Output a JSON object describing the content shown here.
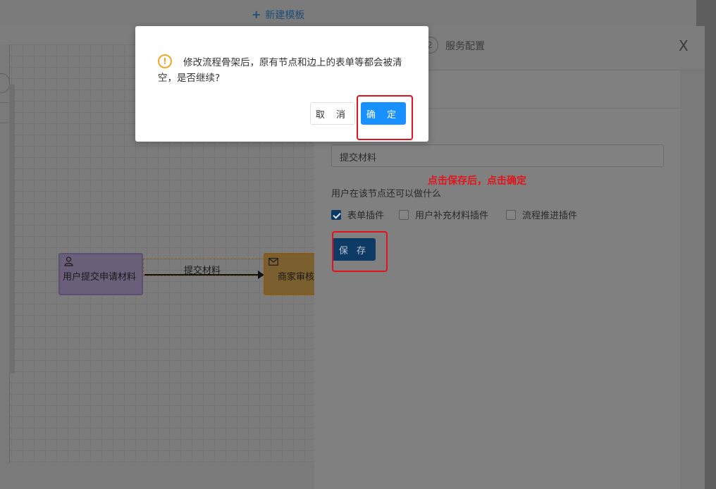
{
  "topbar": {
    "new_template": "新建模板"
  },
  "drawer": {
    "step_number": "2",
    "step_label": "服务配置",
    "close": "X"
  },
  "flow": {
    "user_node_label": "用户提交申请材料",
    "edge_label": "提交材料",
    "biz_node_label": "商家审核"
  },
  "config": {
    "node_name_value": "提交材料",
    "question": "用户在该节点还可以做什么",
    "options": [
      {
        "label": "表单插件",
        "checked": true
      },
      {
        "label": "用户补充材料插件",
        "checked": false
      },
      {
        "label": "流程推进插件",
        "checked": false
      }
    ],
    "save_label": "保 存"
  },
  "annotation": {
    "hint": "点击保存后，点击确定",
    "color": "#e0141a"
  },
  "dialog": {
    "message": "修改流程骨架后，原有节点和边上的表单等都会被清空，是否继续?",
    "cancel_label": "取 消",
    "ok_label": "确 定",
    "primary_color": "#1890ff",
    "warning_color": "#f5a623"
  },
  "icons": {
    "warn": "!",
    "user": "user-icon",
    "mail": "mail-icon",
    "plus": "+"
  }
}
